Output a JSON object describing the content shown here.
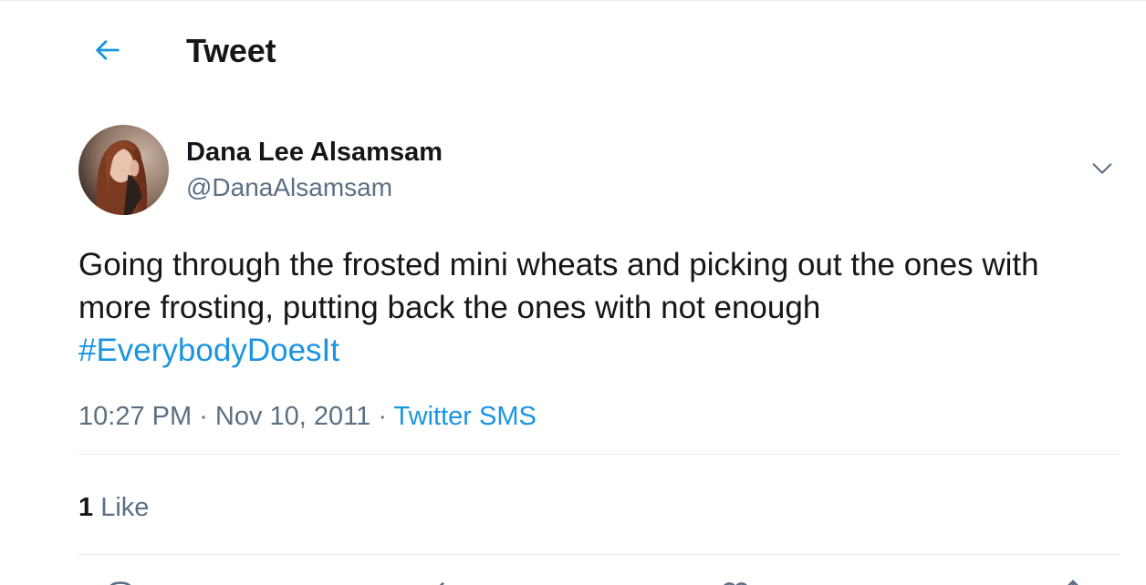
{
  "header": {
    "back_icon": "arrow-left-icon",
    "title": "Tweet"
  },
  "author": {
    "display_name": "Dana Lee Alsamsam",
    "handle": "@DanaAlsamsam",
    "avatar": "profile-photo",
    "more_icon": "chevron-down-icon"
  },
  "tweet": {
    "text": "Going through the frosted mini wheats and picking out the ones with more frosting, putting back the ones with not enough",
    "hashtag": "#EverybodyDoesIt"
  },
  "meta": {
    "time": "10:27 PM",
    "separator": " · ",
    "date": "Nov 10, 2011",
    "source": "Twitter SMS"
  },
  "stats": {
    "likes_count": "1",
    "likes_label": "Like"
  },
  "actions": {
    "reply_icon": "reply-icon",
    "retweet_icon": "retweet-icon",
    "like_icon": "heart-icon",
    "share_icon": "share-icon"
  },
  "colors": {
    "accent": "#1b95e0",
    "text_primary": "#14171a",
    "text_secondary": "#5b7083",
    "divider": "#e6ecf0"
  }
}
